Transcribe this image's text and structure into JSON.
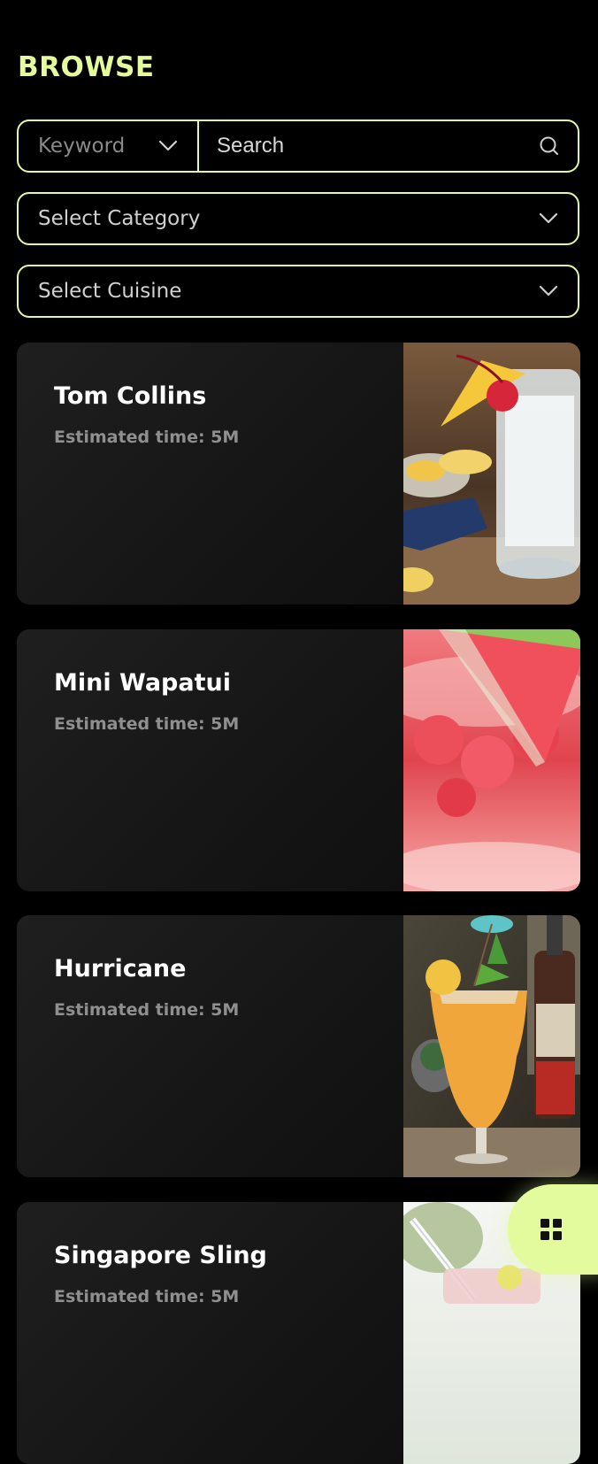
{
  "header": {
    "title": "BROWSE"
  },
  "filters": {
    "keyword_select": "Keyword",
    "search_placeholder": "Search",
    "category_select": "Select Category",
    "cuisine_select": "Select Cuisine"
  },
  "recipes": [
    {
      "name": "Tom Collins",
      "time": "Estimated time: 5M",
      "image": "tom-collins-cocktail-photo"
    },
    {
      "name": "Mini Wapatui",
      "time": "Estimated time: 5M",
      "image": "watermelon-punch-photo"
    },
    {
      "name": "Hurricane",
      "time": "Estimated time: 5M",
      "image": "hurricane-cocktail-photo"
    },
    {
      "name": "Singapore Sling",
      "time": "Estimated time: 5M",
      "image": "singapore-sling-photo"
    }
  ],
  "fab": {
    "icon": "grid-icon"
  },
  "colors": {
    "accent": "#e3fb9c",
    "background": "#000000",
    "card": "#1a1a1a",
    "muted_text": "#8f8f8f"
  }
}
